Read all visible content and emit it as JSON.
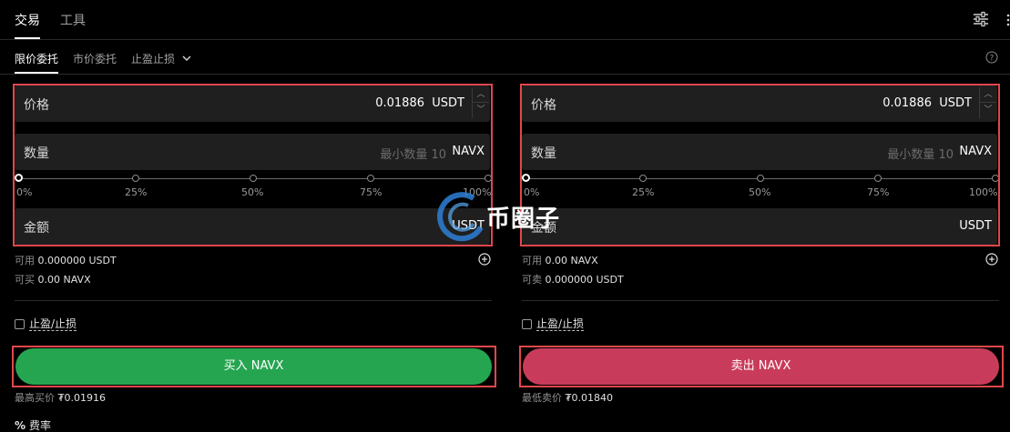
{
  "top_tabs": [
    {
      "label": "交易"
    },
    {
      "label": "工具"
    }
  ],
  "order_tabs": [
    {
      "label": "限价委托"
    },
    {
      "label": "市价委托"
    },
    {
      "label": "止盈止损"
    }
  ],
  "buy": {
    "price_label": "价格",
    "price_value": "0.01886",
    "price_unit": "USDT",
    "qty_label": "数量",
    "qty_placeholder": "最小数量 10",
    "qty_unit": "NAVX",
    "slider_marks": [
      "0%",
      "25%",
      "50%",
      "75%",
      "100%"
    ],
    "slider_value": 0,
    "amount_label": "金额",
    "amount_unit": "USDT",
    "avail_label": "可用",
    "avail_value": "0.000000 USDT",
    "can_label": "可买",
    "can_value": "0.00 NAVX",
    "tpsl_label": "止盈/止损",
    "button_label": "买入 NAVX",
    "best_label": "最高买价",
    "best_value": "₮0.01916"
  },
  "sell": {
    "price_label": "价格",
    "price_value": "0.01886",
    "price_unit": "USDT",
    "qty_label": "数量",
    "qty_placeholder": "最小数量 10",
    "qty_unit": "NAVX",
    "slider_marks": [
      "0%",
      "25%",
      "50%",
      "75%",
      "100%"
    ],
    "slider_value": 0,
    "amount_label": "金额",
    "amount_unit": "USDT",
    "avail_label": "可用",
    "avail_value": "0.00 NAVX",
    "can_label": "可卖",
    "can_value": "0.000000 USDT",
    "tpsl_label": "止盈/止损",
    "button_label": "卖出 NAVX",
    "best_label": "最低卖价",
    "best_value": "₮0.01840"
  },
  "fee": {
    "icon": "percent",
    "label": "费率"
  },
  "watermark": "币圈子",
  "colors": {
    "buy": "#26a550",
    "sell": "#c93b5a",
    "highlight": "#e0474c",
    "background": "#000000"
  },
  "icons": [
    "settings-sliders-icon",
    "more-icon",
    "help-icon",
    "chevron-down-icon",
    "plus-circle-icon",
    "checkbox-icon"
  ]
}
